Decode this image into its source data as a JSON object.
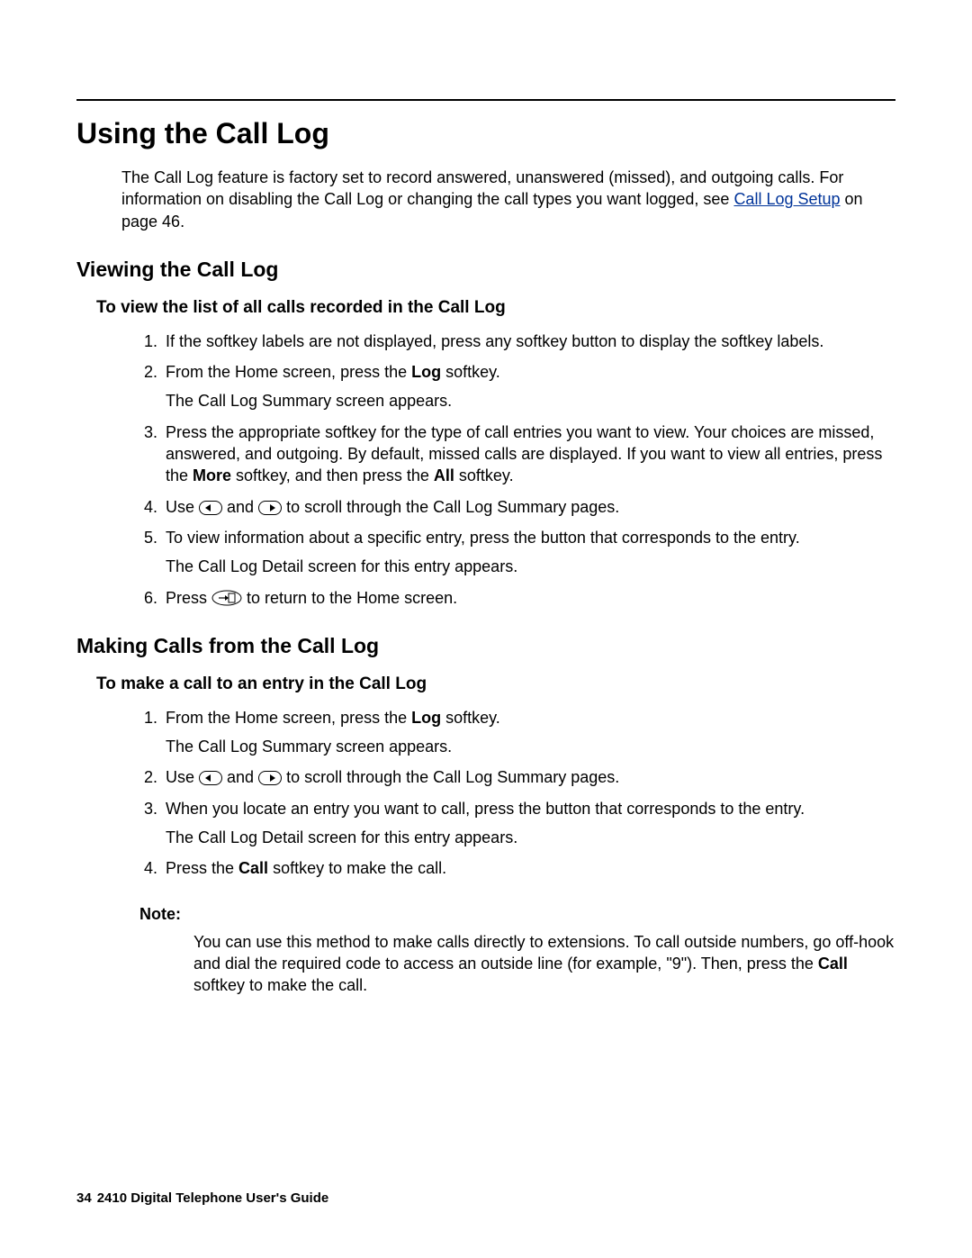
{
  "h1": "Using the Call Log",
  "intro_a": "The Call Log feature is factory set to record answered, unanswered (missed), and outgoing calls. For information on disabling the Call Log or changing the call types you want logged, see ",
  "intro_link": "Call Log Setup",
  "intro_b": " on page 46.",
  "section_view": {
    "h2": "Viewing the Call Log",
    "h3": "To view the list of all calls recorded in the Call Log",
    "step1": "If the softkey labels are not displayed, press any softkey button to display the softkey labels.",
    "step2_a": "From the Home screen, press the ",
    "step2_bold": "Log",
    "step2_b": " softkey.",
    "step2_sub": "The Call Log Summary screen appears.",
    "step3_a": "Press the appropriate softkey for the type of call entries you want to view. Your choices are missed, answered, and outgoing. By default, missed calls are displayed. If you want to view all entries, press the ",
    "step3_bold1": "More",
    "step3_b": " softkey, and then press the ",
    "step3_bold2": "All",
    "step3_c": " softkey.",
    "step4_a": "Use ",
    "step4_b": " and ",
    "step4_c": " to scroll through the Call Log Summary pages.",
    "step5": "To view information about a specific entry, press the button that corresponds to the entry.",
    "step5_sub": "The Call Log Detail screen for this entry appears.",
    "step6_a": "Press ",
    "step6_b": " to return to the Home screen."
  },
  "section_make": {
    "h2": "Making Calls from the Call Log",
    "h3": "To make a call to an entry in the Call Log",
    "step1_a": "From the Home screen, press the ",
    "step1_bold": "Log",
    "step1_b": " softkey.",
    "step1_sub": "The Call Log Summary screen appears.",
    "step2_a": "Use ",
    "step2_b": " and ",
    "step2_c": " to scroll through the Call Log Summary pages.",
    "step3": "When you locate an entry you want to call, press the button that corresponds to the entry.",
    "step3_sub": "The Call Log Detail screen for this entry appears.",
    "step4_a": "Press the ",
    "step4_bold": "Call",
    "step4_b": " softkey to make the call.",
    "note_label": "Note:",
    "note_a": "You can use this method to make calls directly to extensions. To call outside numbers, go off-hook and dial the required code to access an outside line (for example, \"9\"). Then, press the ",
    "note_bold": "Call",
    "note_b": " softkey to make the call."
  },
  "footer": {
    "pagenum": "34",
    "title": "2410 Digital Telephone User's Guide"
  }
}
